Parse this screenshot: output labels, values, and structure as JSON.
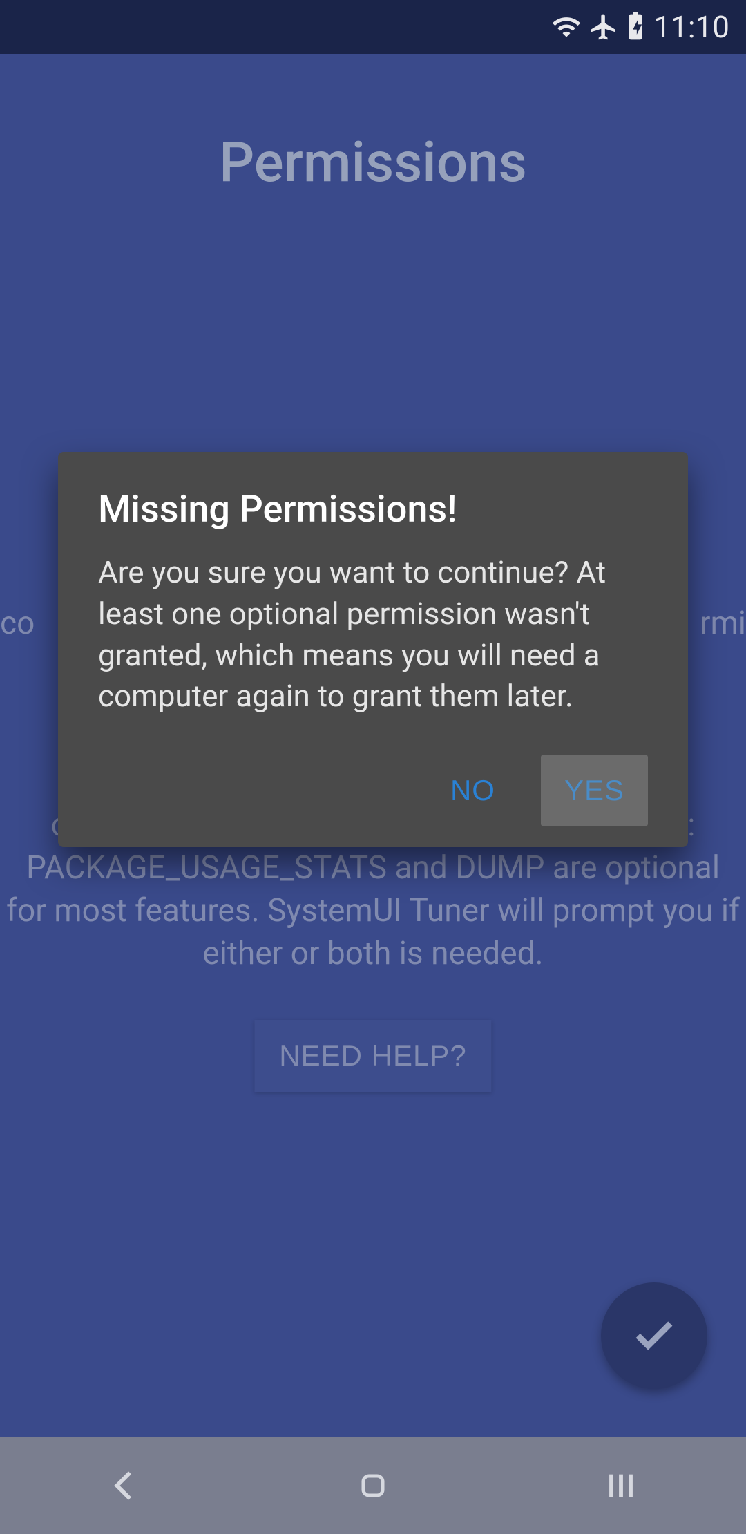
{
  "status_bar": {
    "time": "11:10",
    "icons": [
      "wifi",
      "airplane",
      "battery-charging"
    ]
  },
  "page": {
    "title": "Permissions",
    "bg_text_left": "co",
    "bg_text_right": "rmi",
    "helper_text": "The permissions above must be granted to continue. You'll need to use ADB. Please note: PACKAGE_USAGE_STATS and DUMP are optional for most features. SystemUI Tuner will prompt you if either or both is needed.",
    "need_help_label": "NEED HELP?"
  },
  "dialog": {
    "title": "Missing Permissions!",
    "body": "Are you sure you want to continue? At least one optional permission wasn't granted, which means you will need a computer again to grant them later.",
    "no_label": "NO",
    "yes_label": "YES"
  }
}
